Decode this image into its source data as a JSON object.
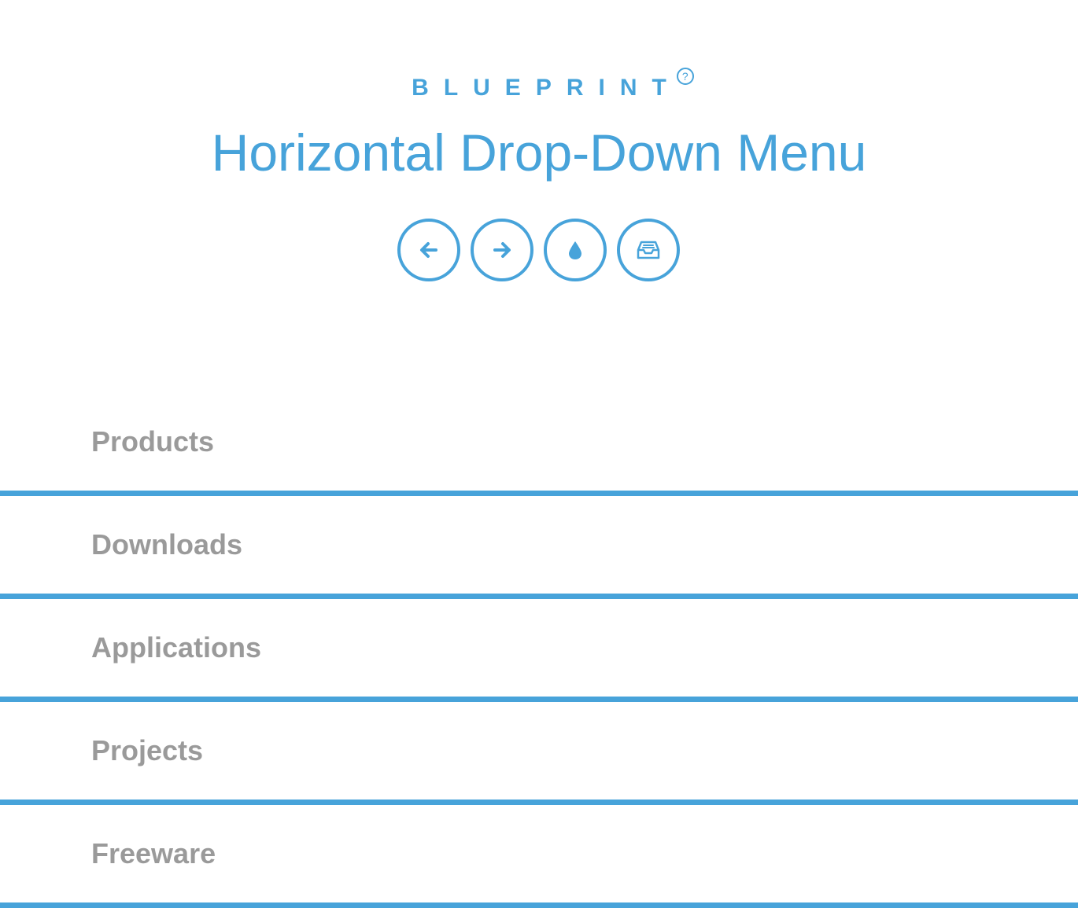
{
  "brand": {
    "name": "BLUEPRINT",
    "help_glyph": "?"
  },
  "page": {
    "title": "Horizontal Drop-Down Menu"
  },
  "toolbar": {
    "buttons": [
      {
        "icon": "arrow-left-icon"
      },
      {
        "icon": "arrow-right-icon"
      },
      {
        "icon": "drop-icon"
      },
      {
        "icon": "inbox-icon"
      }
    ]
  },
  "menu": {
    "items": [
      {
        "label": "Products"
      },
      {
        "label": "Downloads"
      },
      {
        "label": "Applications"
      },
      {
        "label": "Projects"
      },
      {
        "label": "Freeware"
      }
    ]
  },
  "colors": {
    "accent": "#47a3da",
    "menu_text": "#9a9a9a",
    "background": "#ffffff"
  }
}
